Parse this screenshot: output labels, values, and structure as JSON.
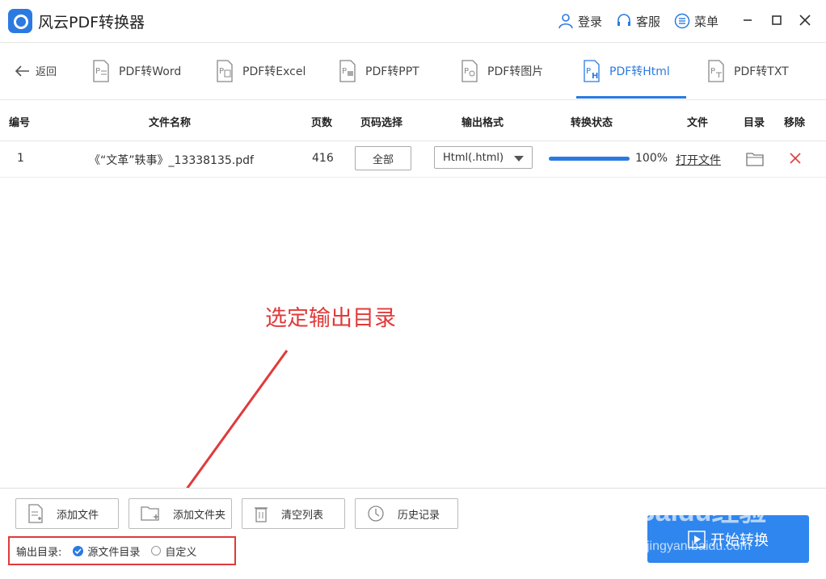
{
  "app": {
    "title": "风云PDF转换器"
  },
  "titlebar": {
    "login": "登录",
    "service": "客服",
    "menu": "菜单"
  },
  "nav": {
    "back": "返回",
    "tabs": [
      {
        "label": "PDF转Word"
      },
      {
        "label": "PDF转Excel"
      },
      {
        "label": "PDF转PPT"
      },
      {
        "label": "PDF转图片"
      },
      {
        "label": "PDF转Html",
        "active": true
      },
      {
        "label": "PDF转TXT"
      }
    ]
  },
  "table": {
    "headers": {
      "num": "编号",
      "name": "文件名称",
      "pages": "页数",
      "page_select": "页码选择",
      "format": "输出格式",
      "status": "转换状态",
      "file": "文件",
      "dir": "目录",
      "remove": "移除"
    },
    "rows": [
      {
        "num": "1",
        "name": "《“文革”轶事》_13338135.pdf",
        "pages": "416",
        "page_select": "全部",
        "format": "Html(.html)",
        "progress": 1.0,
        "progress_text": "100%",
        "file_link": "打开文件"
      }
    ]
  },
  "annotation": "选定输出目录",
  "bottom": {
    "add_file": "添加文件",
    "add_folder": "添加文件夹",
    "clear_list": "清空列表",
    "history": "历史记录",
    "output_label": "输出目录:",
    "option_source": "源文件目录",
    "option_custom": "自定义",
    "start": "开始转换"
  },
  "watermark": {
    "brand": "Baidu经验",
    "url": "jingyan.baidu.com"
  },
  "colors": {
    "accent": "#2a7ae2",
    "annotation": "#e03a3a"
  }
}
